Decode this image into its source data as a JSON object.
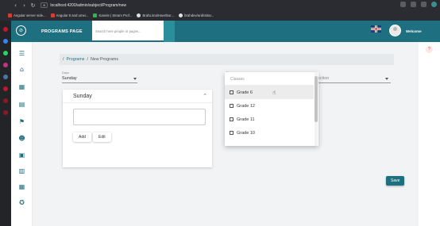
{
  "browser": {
    "url": "localhost:4200/admin/subject/Program/new",
    "bookmarks": [
      {
        "label": "Angular server side...",
        "color": "#d23f31"
      },
      {
        "label": "Angular 8 and umei...",
        "color": "#d23f31"
      },
      {
        "label": "Kanele | Steam Prof...",
        "color": "#2db84d"
      },
      {
        "label": "BrahLima/Haertbor...",
        "color": "#e0e0e0"
      },
      {
        "label": "brahdev/anilimitar...",
        "color": "#e0e0e0"
      }
    ]
  },
  "header": {
    "page_label": "PROGRAMS PAGE",
    "search_placeholder": "Search here people or pages...",
    "welcome": "Welcome"
  },
  "sidenav": {
    "icons": [
      "menu-icon",
      "home-icon",
      "calendar-icon",
      "schedule-icon",
      "teacher-icon",
      "people-icon",
      "classroom-icon",
      "assignment-icon",
      "calendar-event-icon",
      "award-icon"
    ]
  },
  "breadcrumb": {
    "root": "Programs",
    "separator": "/",
    "current": "New Programs"
  },
  "form": {
    "days_label": "Days",
    "days_value": "Sunday",
    "classes_label": "Classes",
    "section_placeholder": "Section"
  },
  "day_card": {
    "title": "Sunday",
    "add_label": "Add",
    "edit_label": "Edit"
  },
  "dropdown": {
    "search_placeholder": "Classes",
    "options": [
      "Grade 6",
      "Grade 12",
      "Grade 11",
      "Grade 10"
    ]
  },
  "actions": {
    "save_label": "Save"
  },
  "colors": {
    "brand": "#1e6f7f",
    "background": "#f1f3f5"
  }
}
